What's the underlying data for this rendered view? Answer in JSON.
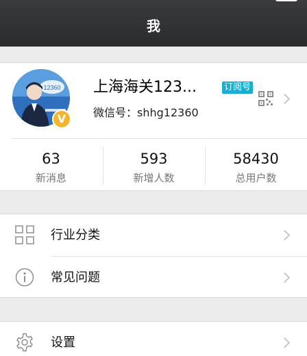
{
  "nav": {
    "title": "我"
  },
  "profile": {
    "account_name": "上海海关123...",
    "badge": "订阅号",
    "wechat_id": "微信号：shhg12360",
    "avatar_text": "12360",
    "verified_mark": "V"
  },
  "stats": [
    {
      "value": "63",
      "label": "新消息"
    },
    {
      "value": "593",
      "label": "新增人数"
    },
    {
      "value": "58430",
      "label": "总用户数"
    }
  ],
  "menu": {
    "items": [
      {
        "label": "行业分类",
        "icon": "grid-icon"
      },
      {
        "label": "常见问题",
        "icon": "info-icon"
      },
      {
        "label": "设置",
        "icon": "gear-icon"
      }
    ]
  },
  "colors": {
    "navbar": "#2f3033",
    "badge": "#1aadd3",
    "verified": "#f4b52b",
    "background": "#ebebeb"
  }
}
